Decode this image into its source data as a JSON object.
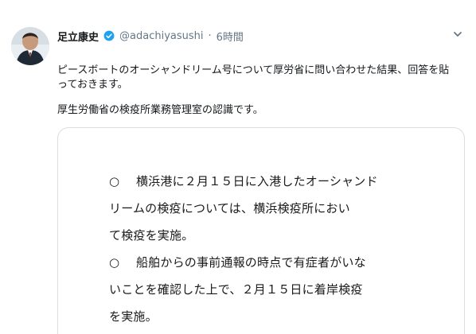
{
  "tweet": {
    "display_name": "足立康史",
    "handle": "@adachiyasushi",
    "separator": "·",
    "time": "6時間",
    "paragraphs": [
      "ピースボートのオーシャンドリーム号について厚労省に問い合わせた結果、回答を貼っておきます。",
      "厚生労働省の検疫所業務管理室の認識です。"
    ],
    "icons": {
      "verified": "verified-badge-icon",
      "menu": "chevron-down-icon"
    },
    "colors": {
      "verified": "#1da1f2",
      "secondary_text": "#657786"
    }
  },
  "attachment": {
    "items": [
      {
        "bullet": "○",
        "lines": [
          "横浜港に２月１５日に入港したオーシャンド",
          "リームの検疫については、横浜検疫所におい",
          "て検疫を実施。"
        ]
      },
      {
        "bullet": "○",
        "lines": [
          "船舶からの事前通報の時点で有症者がいな",
          "いことを確認した上で、２月１５日に着岸検疫",
          "を実施。"
        ]
      }
    ]
  }
}
